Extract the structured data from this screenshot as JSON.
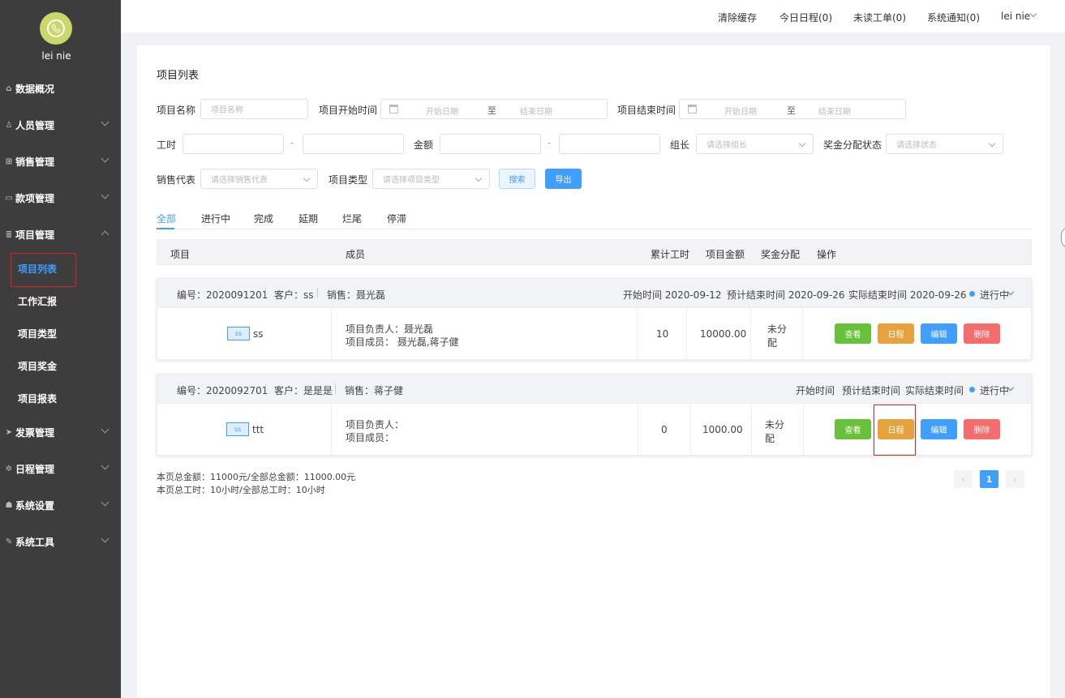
{
  "sidebar": {
    "username": "lei nie",
    "menu": [
      {
        "label": "数据概况",
        "icon": "home-icon"
      },
      {
        "label": "人员管理",
        "icon": "user-icon"
      },
      {
        "label": "销售管理",
        "icon": "cart-icon"
      },
      {
        "label": "款项管理",
        "icon": "money-icon"
      },
      {
        "label": "项目管理",
        "icon": "database-icon"
      },
      {
        "label": "发票管理",
        "icon": "send-icon"
      },
      {
        "label": "日程管理",
        "icon": "gear-icon"
      },
      {
        "label": "系统设置",
        "icon": "users-icon"
      },
      {
        "label": "系统工具",
        "icon": "wrench-icon"
      }
    ],
    "submenu": [
      "项目列表",
      "工作汇报",
      "项目类型",
      "项目奖金",
      "项目报表"
    ]
  },
  "topbar": {
    "clear_cache": "清除缓存",
    "today_schedule": "今日日程(0)",
    "unread_orders": "未读工单(0)",
    "notifications": "系统通知(0)",
    "user": "lei nie"
  },
  "page": {
    "title": "项目列表"
  },
  "filters": {
    "name_label": "项目名称",
    "name_placeholder": "项目名称",
    "start_label": "项目开始时间",
    "end_label": "项目结束时间",
    "start_date_ph": "开始日期",
    "end_date_ph": "结束日期",
    "range_sep": "至",
    "hours_label": "工时",
    "amount_label": "金额",
    "dash": "-",
    "leader_label": "组长",
    "leader_ph": "请选择组长",
    "bonus_status_label": "奖金分配状态",
    "bonus_status_ph": "请选择状态",
    "sales_label": "销售代表",
    "sales_ph": "请选择销售代表",
    "type_label": "项目类型",
    "type_ph": "请选择项目类型",
    "search": "搜索",
    "export": "导出"
  },
  "tabs": [
    "全部",
    "进行中",
    "完成",
    "延期",
    "烂尾",
    "停滞"
  ],
  "table_header": {
    "project": "项目",
    "members": "成员",
    "hours": "累计工时",
    "amount": "项目金额",
    "bonus": "奖金分配",
    "ops": "操作"
  },
  "projects": [
    {
      "code": "编号：2020091201",
      "client": "客户：ss",
      "sales": "销售：聂光磊",
      "start": "开始时间 2020-09-12",
      "est_end": "预计结束时间 2020-09-26",
      "actual_end": "实际结束时间 2020-09-26",
      "status": "进行中",
      "tag": "ss",
      "name": "ss",
      "leader": "项目负责人：聂光磊",
      "members": "项目成员：  聂光磊,蒋子健",
      "hours": "10",
      "amount": "10000.00",
      "bonus_1": "未分",
      "bonus_2": "配"
    },
    {
      "code": "编号：2020092701",
      "client": "客户：是是是",
      "sales": "销售：蒋子健",
      "start": "开始时间",
      "est_end": "预计结束时间",
      "actual_end": "实际结束时间",
      "status": "进行中",
      "tag": "ss",
      "name": "ttt",
      "leader": "项目负责人：",
      "members": "项目成员：",
      "hours": "0",
      "amount": "1000.00",
      "bonus_1": "未分",
      "bonus_2": "配"
    }
  ],
  "actions": {
    "view": "查看",
    "schedule": "日程",
    "edit": "编辑",
    "delete": "删除"
  },
  "summary": {
    "amount": "本页总金额：11000元/全部总金额：11000.00元",
    "hours": "本页总工时：10小时/全部总工时：10小时"
  },
  "pagination": {
    "prev": "‹",
    "current": "1",
    "next": "›"
  }
}
